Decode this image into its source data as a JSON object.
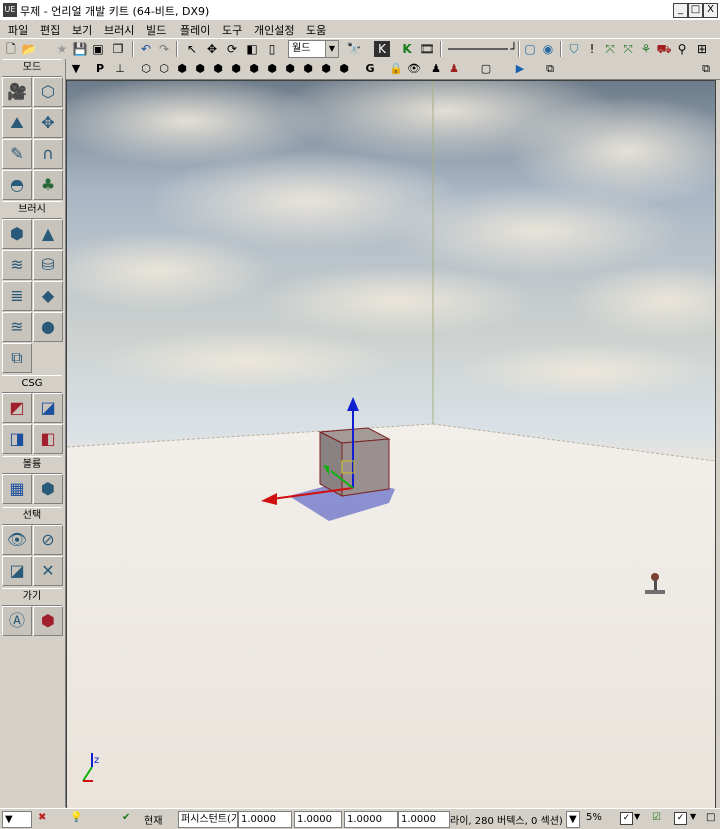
{
  "window": {
    "title": "무제 - 언리얼 개발 키트 (64-비트, DX9)",
    "app_icon": "UE",
    "minimize": "_",
    "maximize": "□",
    "close": "X"
  },
  "menu": [
    "파일",
    "편집",
    "보기",
    "브러시",
    "빌드",
    "플레이",
    "도구",
    "개인설정",
    "도움"
  ],
  "toolbar": {
    "coord_system": "월드",
    "icons": [
      "new-file-icon",
      "open-folder-icon",
      "favorite-icon",
      "save-icon",
      "save-all-icon",
      "copy-icon",
      "undo-icon",
      "redo-icon",
      "select-icon",
      "translate-icon",
      "rotate-icon",
      "scale-icon",
      "scale-nonuniform-icon",
      "find-icon",
      "kismet-icon",
      "content-browser-icon",
      "matinee-icon"
    ]
  },
  "left_panel": {
    "sections": [
      {
        "label": "모드"
      },
      {
        "label": "브러시"
      },
      {
        "label": "CSG"
      },
      {
        "label": "볼륨"
      },
      {
        "label": "선택"
      },
      {
        "label": "가기"
      }
    ],
    "mode_tools": [
      "camera-mode-icon",
      "geometry-mode-icon",
      "terrain-mode-icon",
      "texture-align-icon",
      "mesh-paint-icon",
      "static-mesh-icon",
      "landscape-icon",
      "foliage-icon"
    ],
    "brush_tools": [
      "cube-brush-icon",
      "cone-brush-icon",
      "curved-stair-icon",
      "cylinder-brush-icon",
      "linear-stair-icon",
      "sheet-brush-icon",
      "spiral-stair-icon",
      "sphere-brush-icon",
      "volumetric-brush-icon"
    ],
    "csg_tools": [
      "csg-add-icon",
      "csg-subtract-icon",
      "csg-intersect-icon",
      "csg-deintersect-icon"
    ],
    "volume_tools": [
      "add-volume-icon",
      "add-special-icon"
    ],
    "select_tools": [
      "show-selected-icon",
      "hide-selected-icon",
      "invert-selection-icon",
      "show-all-icon"
    ],
    "goto_tools": [
      "go-to-actor-icon",
      "go-to-builder-brush-icon"
    ]
  },
  "viewport_toolbar": {
    "realtime_label": "P",
    "game_label": "G",
    "lock_icon": "lock-icon"
  },
  "viewport": {
    "axis_z_label": "z"
  },
  "statusbar": {
    "current_label": "현재",
    "persistent_label": "퍼시스턴트(기",
    "drag_x": "1.0000",
    "drag_y": "1.0000",
    "drag_z": "1.0000",
    "drag_w": "1.0000",
    "stats": "라이, 280 버텍스, 0 섹션)",
    "grid_percent": "5%"
  }
}
